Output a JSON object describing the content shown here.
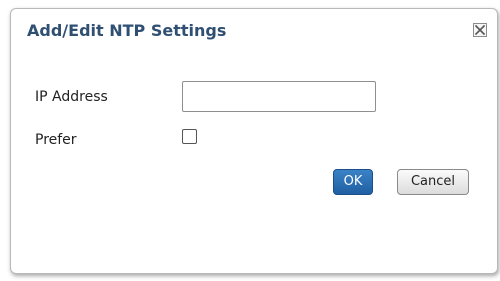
{
  "dialog": {
    "title": "Add/Edit NTP Settings",
    "close_icon": "close-icon",
    "fields": {
      "ip_address": {
        "label": "IP Address",
        "value": "",
        "placeholder": ""
      },
      "prefer": {
        "label": "Prefer",
        "checked": false
      }
    },
    "buttons": {
      "ok_label": "OK",
      "cancel_label": "Cancel"
    }
  },
  "colors": {
    "title": "#2f4f73",
    "ok_button": "#2b6fb4",
    "cancel_button": "#e8e8e8",
    "border": "#b9b9b9"
  }
}
